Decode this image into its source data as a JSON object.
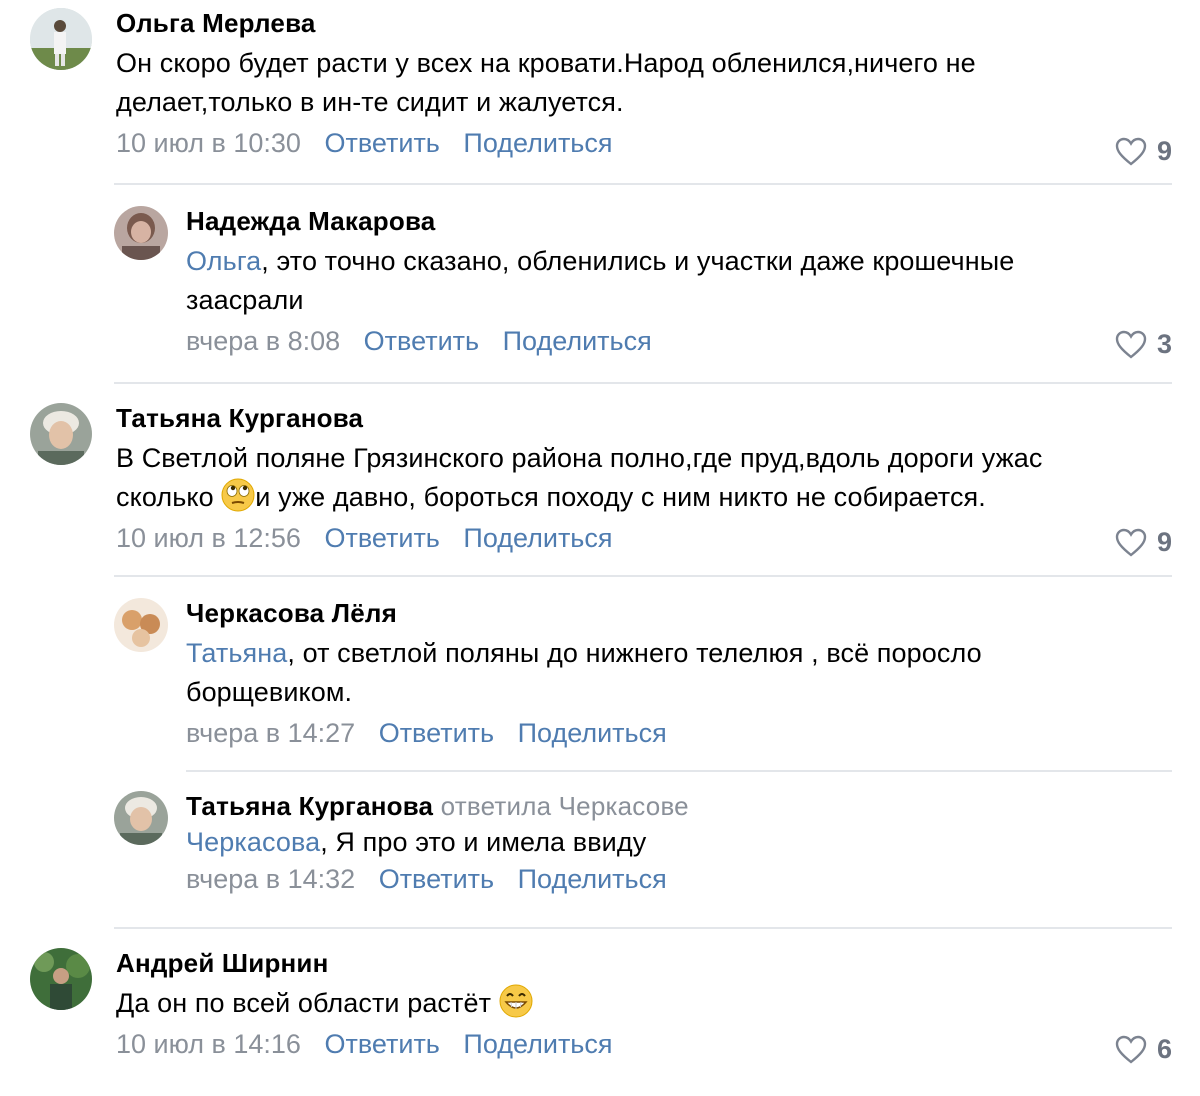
{
  "comments": [
    {
      "author": "Ольга Мерлева",
      "text": "Он скоро будет расти у всех на кровати.Народ обленился,ничего не делает,только в ин-те сидит и жалуется.",
      "date": "10 июл в 10:30",
      "reply": "Ответить",
      "share": "Поделиться",
      "likes": "9"
    },
    {
      "author": "Надежда Макарова",
      "mention": "Ольга",
      "text": ", это точно сказано, обленились и участки даже крошечные заасрали",
      "date": "вчера в 8:08",
      "reply": "Ответить",
      "share": "Поделиться",
      "likes": "3"
    },
    {
      "author": "Татьяна Курганова",
      "text_before": "В Светлой поляне Грязинского района полно,где пруд,вдоль дороги ужас сколько ",
      "text_after": "и уже давно, бороться походу с ним никто не собирается.",
      "emoji": "rolling-eyes-emoji",
      "date": "10 июл в 12:56",
      "reply": "Ответить",
      "share": "Поделиться",
      "likes": "9"
    },
    {
      "author": "Черкасова Лёля",
      "mention": "Татьяна",
      "text": ", от светлой поляны до нижнего телелюя , всё поросло борщевиком.",
      "date": "вчера в 14:27",
      "reply": "Ответить",
      "share": "Поделиться"
    },
    {
      "author": "Татьяна Курганова",
      "replied_to": "ответила Черкасове",
      "mention": "Черкасова",
      "text": ", Я про это и имела ввиду",
      "date": "вчера в 14:32",
      "reply": "Ответить",
      "share": "Поделиться"
    },
    {
      "author": "Андрей Ширнин",
      "text": "Да он по всей области растёт ",
      "emoji": "grinning-emoji",
      "date": "10 июл в 14:16",
      "reply": "Ответить",
      "share": "Поделиться",
      "likes": "6"
    }
  ],
  "colors": {
    "link": "#4f7cb0",
    "muted": "#8a9099",
    "divider": "#e3e6ea",
    "likes": "#6c7380"
  },
  "icons": {
    "like": "heart-outline-icon"
  }
}
